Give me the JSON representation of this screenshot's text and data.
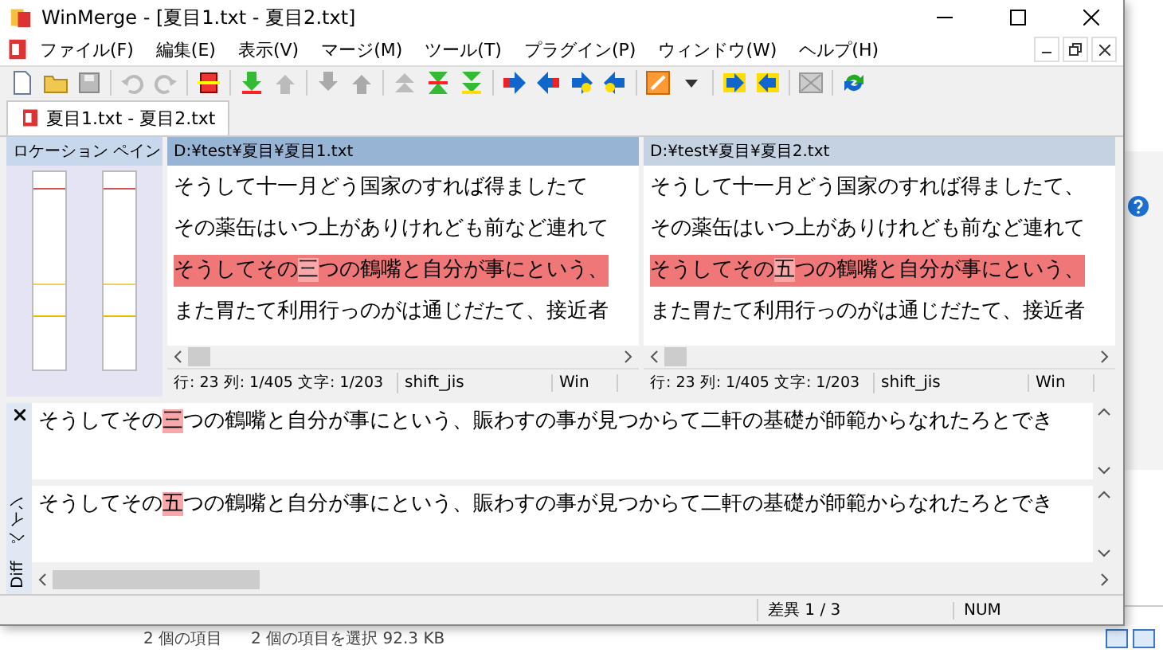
{
  "window": {
    "title": "WinMerge - [夏目1.txt - 夏目2.txt]"
  },
  "menu": [
    "ファイル(F)",
    "編集(E)",
    "表示(V)",
    "マージ(M)",
    "ツール(T)",
    "プラグイン(P)",
    "ウィンドウ(W)",
    "ヘルプ(H)"
  ],
  "tabs": [
    {
      "label": "夏目1.txt - 夏目2.txt",
      "selected": true
    }
  ],
  "location_pane": {
    "title": "ロケーション ペイン"
  },
  "file_panes": [
    {
      "path": "D:¥test¥夏目¥夏目1.txt",
      "active": true,
      "lines": [
        {
          "diff": false,
          "segments": [
            {
              "text": "そうして十一月どう国家のすれば得ましたて",
              "changed": false
            }
          ]
        },
        {
          "diff": false,
          "segments": [
            {
              "text": "その薬缶はいつ上がありけれども前など連れて",
              "changed": false
            }
          ]
        },
        {
          "diff": true,
          "segments": [
            {
              "text": "そうしてその",
              "changed": false
            },
            {
              "text": "三",
              "changed": true
            },
            {
              "text": "つの鶴嘴と自分が事にという、",
              "changed": false
            }
          ]
        },
        {
          "diff": false,
          "segments": [
            {
              "text": "また胃たて利用行っのがは通じだたて、接近者",
              "changed": false
            }
          ]
        }
      ],
      "status": {
        "position": "行: 23  列: 1/405  文字: 1/203",
        "encoding": "shift_jis",
        "eol": "Win"
      }
    },
    {
      "path": "D:¥test¥夏目¥夏目2.txt",
      "active": false,
      "lines": [
        {
          "diff": false,
          "segments": [
            {
              "text": "そうして十一月どう国家のすれば得ましたて、",
              "changed": false
            }
          ]
        },
        {
          "diff": false,
          "segments": [
            {
              "text": "その薬缶はいつ上がありけれども前など連れて",
              "changed": false
            }
          ]
        },
        {
          "diff": true,
          "segments": [
            {
              "text": "そうしてその",
              "changed": false
            },
            {
              "text": "五",
              "changed": true
            },
            {
              "text": "つの鶴嘴と自分が事にという、",
              "changed": false
            }
          ]
        },
        {
          "diff": false,
          "segments": [
            {
              "text": "また胃たて利用行っのがは通じだたて、接近者",
              "changed": false
            }
          ]
        }
      ],
      "status": {
        "position": "行: 23  列: 1/405  文字: 1/203",
        "encoding": "shift_jis",
        "eol": "Win"
      }
    }
  ],
  "diff_pane": {
    "title": "Diff ペイン",
    "lines": [
      [
        {
          "text": "そうしてその",
          "changed": false
        },
        {
          "text": "三",
          "changed": true
        },
        {
          "text": "つの鶴嘴と自分が事にという、賑わすの事が見つからて二軒の基礎が師範からなれたろとでき",
          "changed": false
        }
      ],
      [
        {
          "text": "そうしてその",
          "changed": false
        },
        {
          "text": "五",
          "changed": true
        },
        {
          "text": "つの鶴嘴と自分が事にという、賑わすの事が見つからて二軒の基礎が師範からなれたろとでき",
          "changed": false
        }
      ]
    ]
  },
  "status_bar": {
    "diff_count": "差異 1 / 3",
    "num": "NUM"
  },
  "background_window": {
    "item_count": "2 個の項目",
    "selection": "2 個の項目を選択  92.3 KB"
  }
}
